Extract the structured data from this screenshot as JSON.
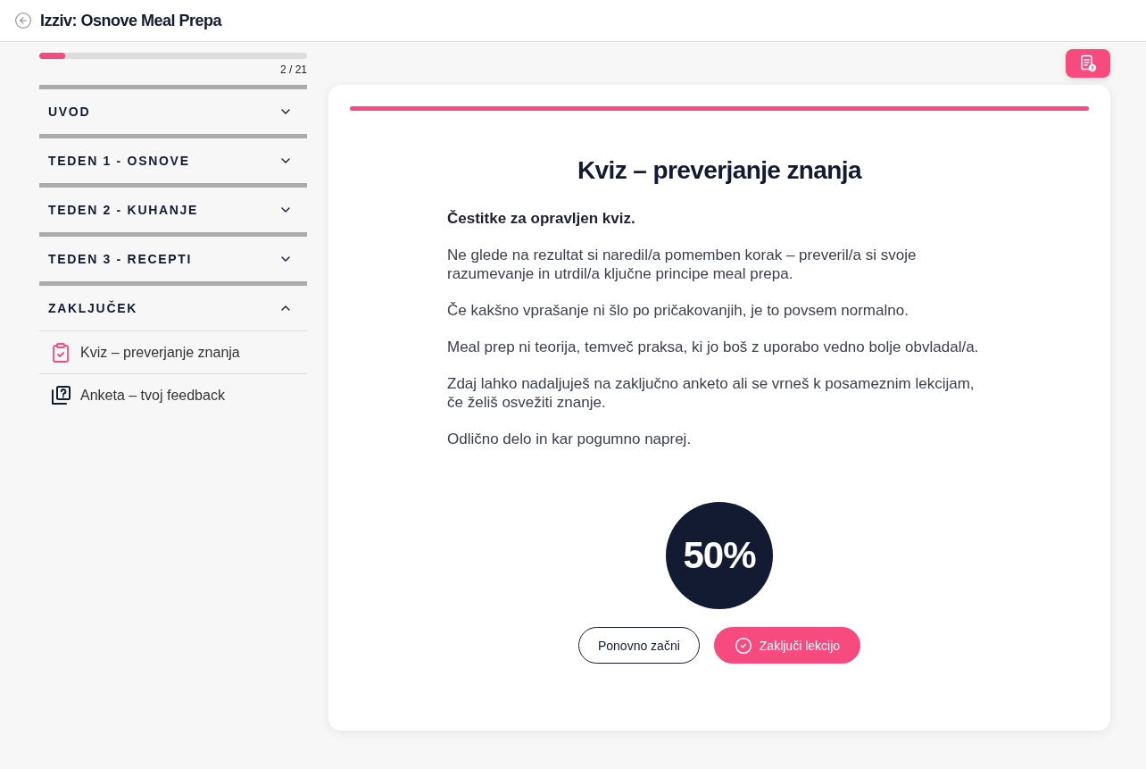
{
  "header": {
    "title": "Izziv: Osnove Meal Prepa"
  },
  "progress": {
    "level": 0.095,
    "count": "2 / 21"
  },
  "sections": [
    {
      "title": "UVOD",
      "expanded": false
    },
    {
      "title": "TEDEN 1 - OSNOVE",
      "expanded": false
    },
    {
      "title": "TEDEN 2 - KUHANJE",
      "expanded": false
    },
    {
      "title": "TEDEN 3 - RECEPTI",
      "expanded": false
    },
    {
      "title": "ZAKLJUČEK",
      "expanded": true,
      "lessons": [
        {
          "title": "Kviz – preverjanje znanja",
          "kind": "quiz",
          "selected": true
        },
        {
          "title": "Anketa – tvoj feedback",
          "kind": "survey",
          "selected": false
        }
      ]
    }
  ],
  "card": {
    "title": "Kviz – preverjanje znanja",
    "intro": "Čestitke za opravljen kviz.",
    "paragraphs": [
      "Ne glede na rezultat si naredil/a pomemben korak – preveril/a si svoje razumevanje in utrdil/a ključne principe meal prepa.",
      "Če kakšno vprašanje ni šlo po pričakovanjih, je to povsem normalno.",
      "Meal prep ni teorija, temveč praksa, ki jo boš z uporabo vedno bolje obvladal/a.",
      "Zdaj lahko nadaljuješ na zaključno anketo ali se vrneš k posameznim lekcijam, če želiš osvežiti znanje.",
      "Odlično delo in kar pogumno naprej."
    ],
    "score": "50%",
    "buttons": [
      {
        "label": "Ponovno začni",
        "kind": "outline"
      },
      {
        "label": "Zaključi lekcijo",
        "kind": "primary"
      }
    ]
  }
}
